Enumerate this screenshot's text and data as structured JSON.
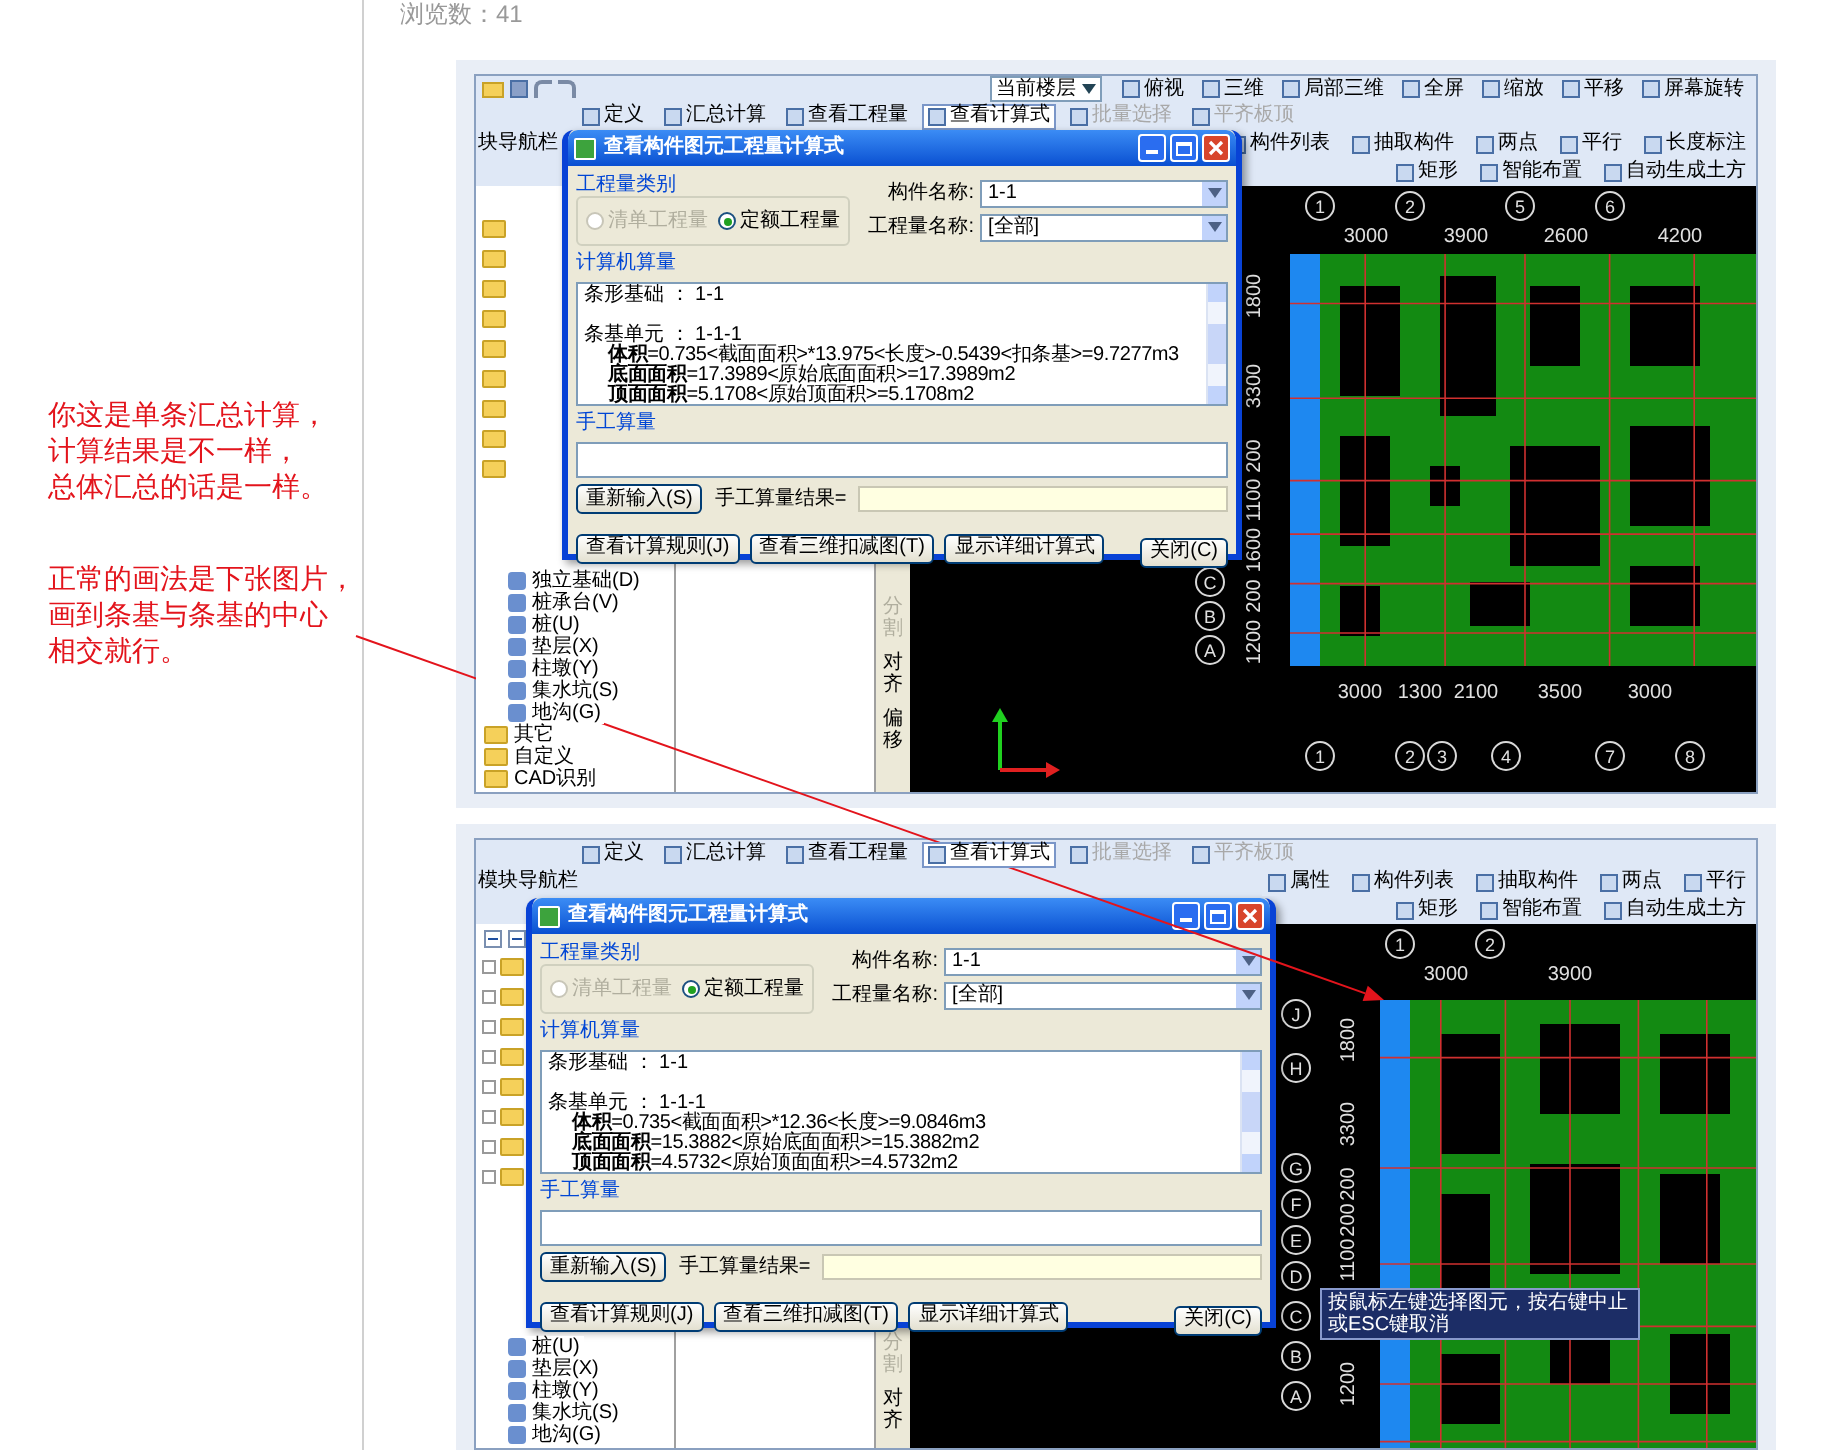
{
  "view_count": "浏览数：41",
  "annotation": [
    [
      "你这是单条汇总计算，",
      "计算结果是不一样，",
      "总体汇总的话是一样。"
    ],
    [
      "正常的画法是下张图片，",
      "画到条基与条基的中心",
      "相交就行。"
    ]
  ],
  "screenshots": [
    {
      "view_toolbar": [
        {
          "kind": "dropdown",
          "label": "当前楼层"
        },
        {
          "kind": "button",
          "label": "俯视"
        },
        {
          "kind": "button",
          "label": "三维"
        },
        {
          "kind": "button",
          "label": "局部三维"
        },
        {
          "kind": "button",
          "label": "全屏"
        },
        {
          "kind": "button",
          "label": "缩放"
        },
        {
          "kind": "button",
          "label": "平移"
        },
        {
          "kind": "button",
          "label": "屏幕旋转"
        }
      ],
      "command_toolbar": [
        {
          "label": "定义",
          "selected": false,
          "disabled": false
        },
        {
          "label": "汇总计算",
          "selected": false,
          "disabled": false
        },
        {
          "label": "查看工程量",
          "selected": false,
          "disabled": false
        },
        {
          "label": "查看计算式",
          "selected": true,
          "disabled": false
        },
        {
          "label": "批量选择",
          "selected": false,
          "disabled": true
        },
        {
          "label": "平齐板顶",
          "selected": false,
          "disabled": true
        }
      ],
      "nav_title": "块导航栏",
      "panel_tools": [
        "构件列表",
        "抽取构件",
        "两点",
        "平行",
        "长度标注"
      ],
      "draw_tools": [
        "矩形",
        "智能布置",
        "自动生成土方"
      ],
      "tree_items": [
        {
          "kind": "leaf",
          "label": "独立基础(D)"
        },
        {
          "kind": "leaf",
          "label": "桩承台(V)"
        },
        {
          "kind": "leaf",
          "label": "桩(U)"
        },
        {
          "kind": "leaf",
          "label": "垫层(X)"
        },
        {
          "kind": "leaf",
          "label": "柱墩(Y)"
        },
        {
          "kind": "leaf",
          "label": "集水坑(S)"
        },
        {
          "kind": "leaf",
          "label": "地沟(G)"
        },
        {
          "kind": "folder",
          "label": "其它"
        },
        {
          "kind": "folder",
          "label": "自定义"
        },
        {
          "kind": "folder",
          "label": "CAD识别"
        }
      ],
      "side_tools": [
        {
          "label": "分割",
          "disabled": true
        },
        {
          "label": "对齐",
          "disabled": false
        },
        {
          "label": "偏移",
          "disabled": false
        }
      ],
      "dialog": {
        "title": "查看构件图元工程量计算式",
        "category_label": "工程量类别",
        "options": [
          {
            "label": "清单工程量",
            "selected": false,
            "disabled": true
          },
          {
            "label": "定额工程量",
            "selected": true,
            "disabled": false
          }
        ],
        "fields": [
          {
            "label": "构件名称:",
            "value": "1-1"
          },
          {
            "label": "工程量名称:",
            "value": "[全部]"
          }
        ],
        "computed_label": "计算机算量",
        "computed_lines": [
          {
            "kind": "heading",
            "text": "条形基础 ： 1-1"
          },
          {
            "kind": "heading",
            "text": "条基单元 ： 1-1-1"
          },
          {
            "kind": "formula",
            "text": "**体积**=0.735<截面面积>*13.975<长度>-0.5439<扣条基>=9.7277m3"
          },
          {
            "kind": "formula",
            "text": "**底面面积**=17.3989<原始底面面积>=17.3989m2"
          },
          {
            "kind": "formula",
            "text": "**顶面面积**=5.1708<原始顶面积>=5.1708m2"
          }
        ],
        "manual_label": "手工算量",
        "reenter_button": "重新输入(S)",
        "result_label": "手工算量结果=",
        "buttons": [
          "查看计算规则(J)",
          "查看三维扣减图(T)",
          "显示详细计算式"
        ],
        "close_button": "关闭(C)"
      },
      "plan": {
        "top_axes": [
          "1",
          "2",
          "5",
          "6"
        ],
        "top_dims": [
          "3000",
          "3900",
          "2600",
          "4200"
        ],
        "left_axes": [
          "C",
          "B",
          "A"
        ],
        "side_dims": [
          "1800",
          "3300",
          "200",
          "1100",
          "1600",
          "200",
          "1200"
        ],
        "bottom_dims": [
          "3000",
          "1300",
          "2100",
          "3500",
          "3000"
        ],
        "bottom_axes": [
          "1",
          "2",
          "3",
          "4",
          "7",
          "8"
        ]
      }
    },
    {
      "command_toolbar": [
        {
          "label": "定义",
          "selected": false,
          "disabled": false
        },
        {
          "label": "汇总计算",
          "selected": false,
          "disabled": false
        },
        {
          "label": "查看工程量",
          "selected": false,
          "disabled": false
        },
        {
          "label": "查看计算式",
          "selected": true,
          "disabled": false
        },
        {
          "label": "批量选择",
          "selected": false,
          "disabled": true
        },
        {
          "label": "平齐板顶",
          "selected": false,
          "disabled": true
        }
      ],
      "nav_title": "模块导航栏",
      "panel_tools": [
        "属性",
        "构件列表",
        "抽取构件",
        "两点",
        "平行"
      ],
      "draw_tools": [
        "矩形",
        "智能布置",
        "自动生成土方"
      ],
      "tree_items": [
        {
          "kind": "leaf",
          "label": "桩(U)"
        },
        {
          "kind": "leaf",
          "label": "垫层(X)"
        },
        {
          "kind": "leaf",
          "label": "柱墩(Y)"
        },
        {
          "kind": "leaf",
          "label": "集水坑(S)"
        },
        {
          "kind": "leaf",
          "label": "地沟(G)"
        }
      ],
      "side_tools": [
        {
          "label": "分割",
          "disabled": true
        },
        {
          "label": "对齐",
          "disabled": false
        }
      ],
      "dialog": {
        "title": "查看构件图元工程量计算式",
        "category_label": "工程量类别",
        "options": [
          {
            "label": "清单工程量",
            "selected": false,
            "disabled": true
          },
          {
            "label": "定额工程量",
            "selected": true,
            "disabled": false
          }
        ],
        "fields": [
          {
            "label": "构件名称:",
            "value": "1-1"
          },
          {
            "label": "工程量名称:",
            "value": "[全部]"
          }
        ],
        "computed_label": "计算机算量",
        "computed_lines": [
          {
            "kind": "heading",
            "text": "条形基础 ： 1-1"
          },
          {
            "kind": "heading",
            "text": "条基单元 ： 1-1-1"
          },
          {
            "kind": "formula",
            "text": "**体积**=0.735<截面面积>*12.36<长度>=9.0846m3"
          },
          {
            "kind": "formula",
            "text": "**底面面积**=15.3882<原始底面面积>=15.3882m2"
          },
          {
            "kind": "formula",
            "text": "**顶面面积**=4.5732<原始顶面面积>=4.5732m2"
          }
        ],
        "manual_label": "手工算量",
        "reenter_button": "重新输入(S)",
        "result_label": "手工算量结果=",
        "buttons": [
          "查看计算规则(J)",
          "查看三维扣减图(T)",
          "显示详细计算式"
        ],
        "close_button": "关闭(C)"
      },
      "plan": {
        "top_axes": [
          "1",
          "2"
        ],
        "top_dims": [
          "3000",
          "3900"
        ],
        "left_axes": [
          "J",
          "H",
          "G",
          "F",
          "E",
          "D",
          "C",
          "B",
          "A"
        ],
        "side_dims": [
          "1800",
          "3300",
          "200",
          "200",
          "1100",
          "1200"
        ],
        "tooltip": "按鼠标左键选择图元，按右键中止或ESC键取消"
      }
    }
  ]
}
